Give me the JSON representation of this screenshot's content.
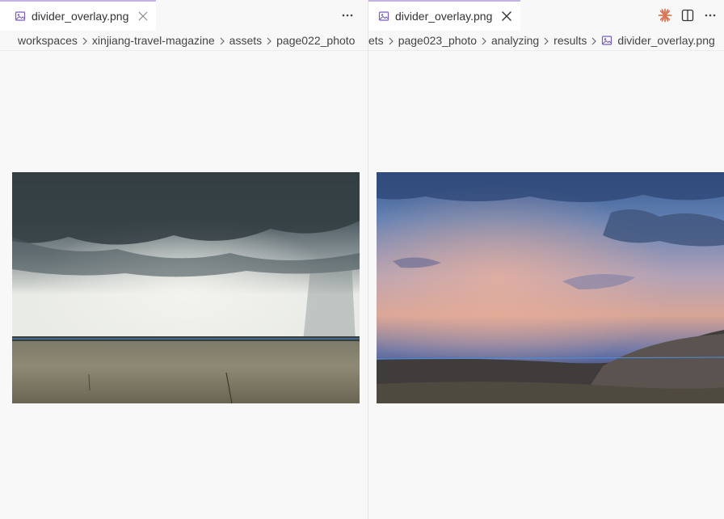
{
  "left_editor": {
    "tab": {
      "title": "divider_overlay.png"
    },
    "breadcrumb": [
      "workspaces",
      "xinjiang-travel-magazine",
      "assets",
      "page022_photo"
    ]
  },
  "right_editor": {
    "tab": {
      "title": "divider_overlay.png"
    },
    "breadcrumb": [
      "ets",
      "page023_photo",
      "analyzing",
      "results",
      "divider_overlay.png"
    ]
  },
  "icons": {
    "image_file": "image-file-icon",
    "close": "close-icon",
    "more": "more-actions-icon",
    "claude": "claude-spark-icon",
    "split": "split-editor-icon",
    "chevron": "chevron-right-icon"
  },
  "colors": {
    "tab_accent": "#c5b3e6",
    "image_icon": "#7a5cc0",
    "claude_orange": "#d97757",
    "divider_line": "#4a90e2"
  }
}
